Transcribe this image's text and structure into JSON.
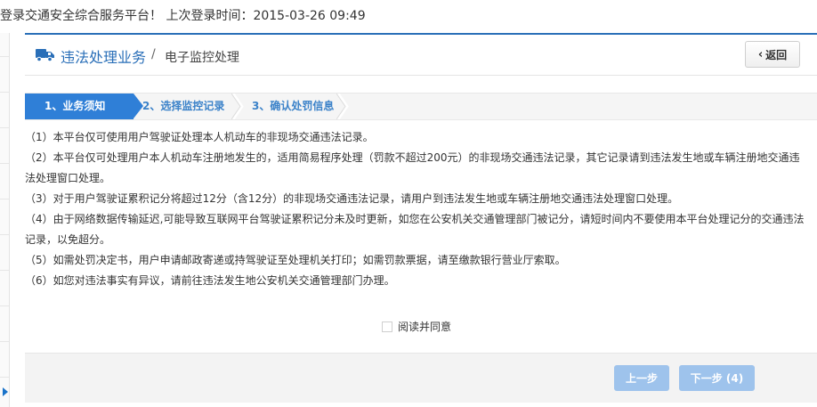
{
  "top_bar": {
    "login_text": "登录交通安全综合服务平台！ 上次登录时间：2015-03-26 09:49"
  },
  "header": {
    "title": "违法处理业务",
    "separator": "/",
    "subtitle": "电子监控处理",
    "back_label": "返回"
  },
  "steps": [
    {
      "label": "1、业务须知",
      "active": true
    },
    {
      "label": "2、选择监控记录",
      "active": false
    },
    {
      "label": "3、确认处罚信息",
      "active": false
    }
  ],
  "notice": [
    "（1）本平台仅可使用用户驾驶证处理本人机动车的非现场交通违法记录。",
    "（2）本平台仅可处理用户本人机动车注册地发生的，适用简易程序处理（罚款不超过200元）的非现场交通违法记录，其它记录请到违法发生地或车辆注册地交通违法处理窗口处理。",
    "（3）对于用户驾驶证累积记分将超过12分（含12分）的非现场交通违法记录，请用户到违法发生地或车辆注册地交通违法处理窗口处理。",
    "（4）由于网络数据传输延迟,可能导致互联网平台驾驶证累积记分未及时更新，如您在公安机关交通管理部门被记分，请短时间内不要使用本平台处理记分的交通违法记录，以免超分。",
    "（5）如需处罚决定书，用户申请邮政寄递或持驾驶证至处理机关打印；如需罚款票据，请至缴款银行营业厅索取。",
    "（6）如您对违法事实有异议，请前往违法发生地公安机关交通管理部门办理。"
  ],
  "agree": {
    "label": "阅读并同意",
    "checked": false
  },
  "footer": {
    "prev_label": "上一步",
    "next_label": "下一步 (4)"
  },
  "colors": {
    "accent": "#2f7fd7",
    "title_blue": "#2a6fb8",
    "button_disabled": "#9ec3ec"
  },
  "icons": {
    "header": "truck-icon",
    "back": "chevron-left-icon",
    "rail": "caret-right-icon"
  }
}
